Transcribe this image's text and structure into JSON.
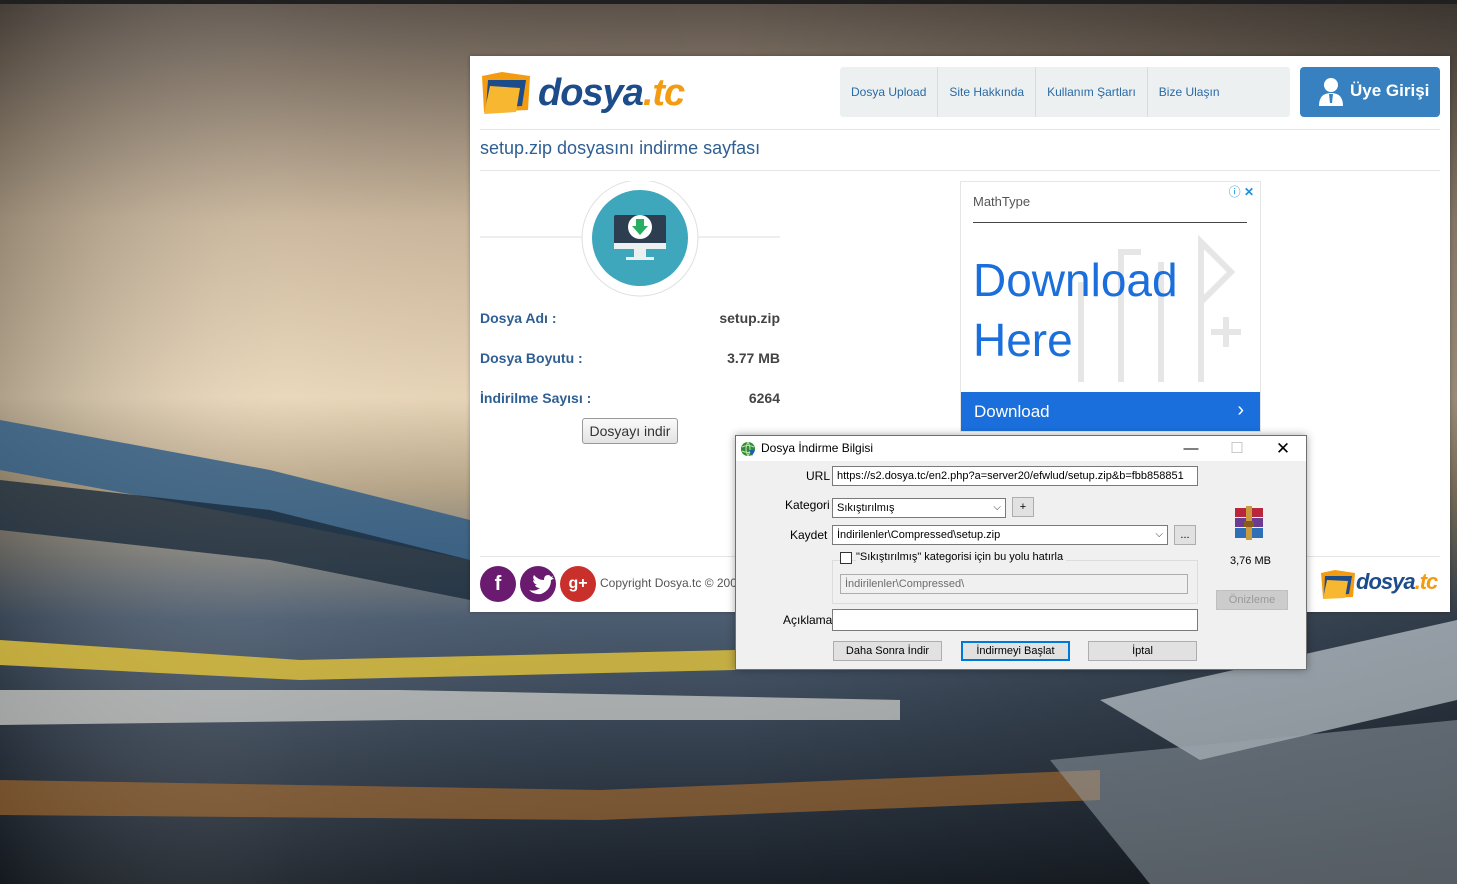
{
  "site": {
    "logo": {
      "name": "dosya",
      "tld": ".tc"
    },
    "nav": [
      {
        "label": "Dosya Upload"
      },
      {
        "label": "Site Hakkında"
      },
      {
        "label": "Kullanım Şartları"
      },
      {
        "label": "Bize Ulaşın"
      }
    ],
    "member_button": "Üye Girişi",
    "page_title": "setup.zip dosyasını indirme sayfası",
    "file_info": [
      {
        "key": "Dosya Adı :",
        "value": "setup.zip"
      },
      {
        "key": "Dosya Boyutu :",
        "value": "3.77 MB"
      },
      {
        "key": "İndirilme Sayısı :",
        "value": "6264"
      }
    ],
    "download_button": "Dosyayı indir",
    "copyright": "Copyright Dosya.tc © 200",
    "colors": {
      "accent": "#3781c0",
      "title": "#2f5f92",
      "ad_blue": "#1a6fdc"
    }
  },
  "ad": {
    "brand": "MathType",
    "headline": "Download Here",
    "cta": "Download",
    "icons": [
      "info-icon",
      "close-icon"
    ]
  },
  "dialog": {
    "title": "Dosya İndirme Bilgisi",
    "url_label": "URL",
    "url_value": "https://s2.dosya.tc/en2.php?a=server20/efwlud/setup.zip&b=fbb858851",
    "category_label": "Kategori",
    "category_value": "Sıkıştırılmış",
    "add_button": "+",
    "save_label": "Kaydet",
    "save_value": "İndirilenler\\Compressed\\setup.zip",
    "browse_button": "...",
    "remember_label": "\"Sıkıştırılmış\" kategorisi için bu yolu hatırla",
    "remember_path": "İndirilenler\\Compressed\\",
    "description_label": "Açıklama",
    "description_value": "",
    "file_size": "3,76  MB",
    "preview_button": "Önizleme",
    "later_button": "Daha Sonra İndir",
    "start_button": "İndirmeyi Başlat",
    "cancel_button": "İptal",
    "window_buttons": [
      "minimize-icon",
      "maximize-icon",
      "close-icon"
    ]
  }
}
